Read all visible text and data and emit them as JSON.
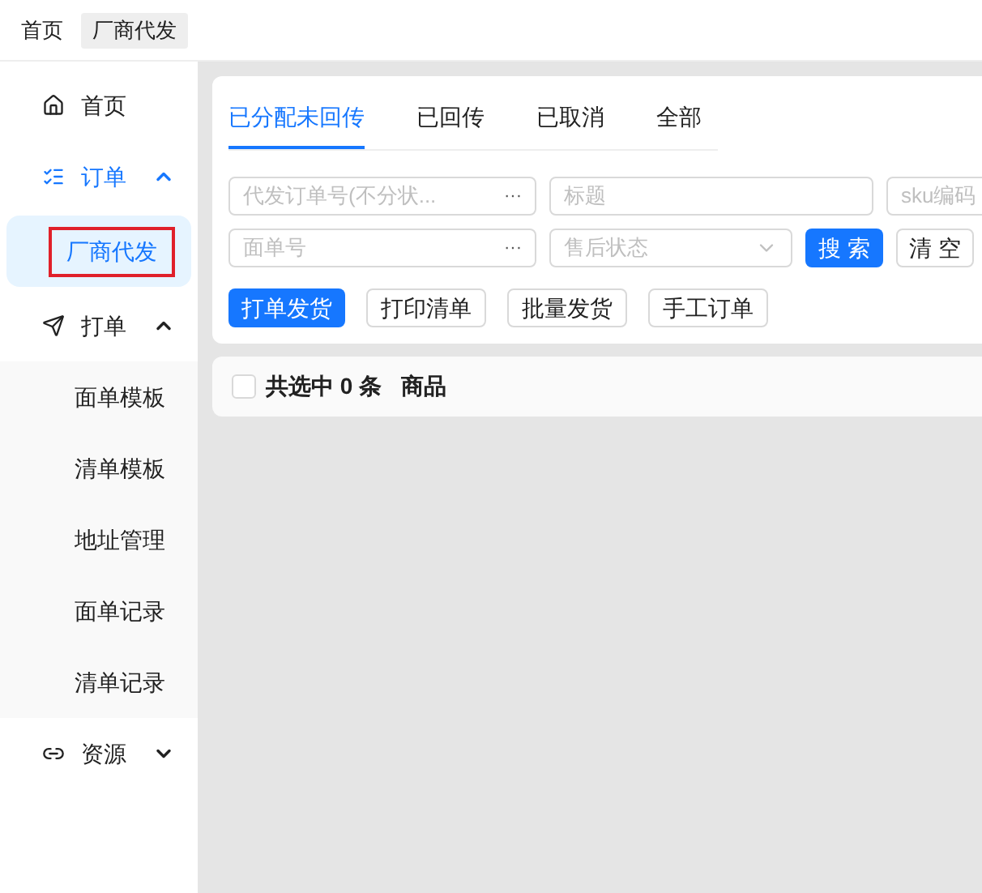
{
  "top_tabs": [
    {
      "label": "首页",
      "selected": false
    },
    {
      "label": "厂商代发",
      "selected": true
    }
  ],
  "sidebar": {
    "items": [
      {
        "label": "首页",
        "selected": false
      },
      {
        "label": "订单",
        "expanded": true,
        "selected": true,
        "children": [
          {
            "label": "厂商代发",
            "selected": true,
            "outlined": true
          }
        ]
      },
      {
        "label": "打单",
        "expanded": true,
        "selected": false,
        "children": [
          {
            "label": "面单模板",
            "selected": false,
            "outlined": false
          },
          {
            "label": "清单模板",
            "selected": false,
            "outlined": false
          },
          {
            "label": "地址管理",
            "selected": false,
            "outlined": false
          },
          {
            "label": "面单记录",
            "selected": false,
            "outlined": false
          },
          {
            "label": "清单记录",
            "selected": false,
            "outlined": false
          }
        ]
      },
      {
        "label": "资源",
        "expanded": false,
        "selected": false
      }
    ]
  },
  "tabs": [
    {
      "label": "已分配未回传",
      "selected": true
    },
    {
      "label": "已回传",
      "selected": false
    },
    {
      "label": "已取消",
      "selected": false
    },
    {
      "label": "全部",
      "selected": false
    }
  ],
  "filters": [
    [
      {
        "kind": "more",
        "placeholder": "代发订单号(不分状...",
        "more": "···"
      },
      {
        "kind": "input",
        "placeholder": "标题"
      },
      {
        "kind": "input",
        "placeholder": "sku编码"
      }
    ],
    [
      {
        "kind": "more",
        "placeholder": "面单号",
        "more": "···"
      },
      {
        "kind": "select",
        "placeholder": "售后状态"
      },
      {
        "kind": "primary",
        "label": "搜 索"
      },
      {
        "kind": "default",
        "label": "清 空"
      }
    ]
  ],
  "actions": [
    {
      "label": "打单发货",
      "kind": "primary"
    },
    {
      "label": "打印清单",
      "kind": "default"
    },
    {
      "label": "批量发货",
      "kind": "default"
    },
    {
      "label": "手工订单",
      "kind": "default"
    }
  ],
  "selection_bar": {
    "checked": false,
    "summary": "共选中 0 条",
    "column": "商品"
  }
}
